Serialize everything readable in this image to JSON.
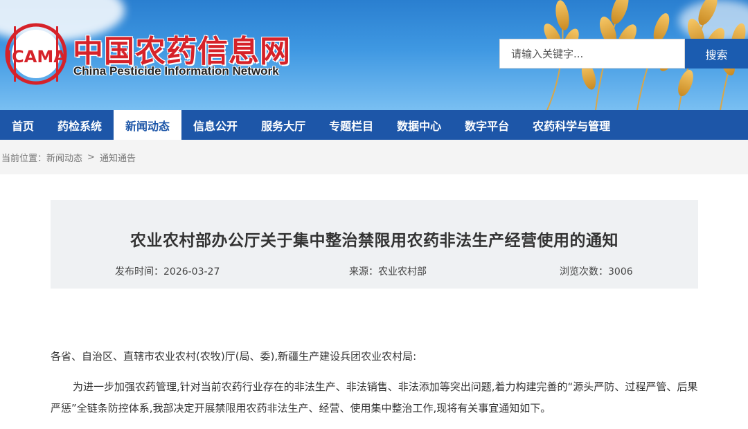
{
  "header": {
    "logo_text": "ICAMA",
    "site_title": "中国农药信息网",
    "site_subtitle": "China Pesticide Information Network",
    "search_placeholder": "请输入关键字...",
    "search_button": "搜索"
  },
  "nav": {
    "items": [
      {
        "label": "首页",
        "active": false
      },
      {
        "label": "药检系统",
        "active": false
      },
      {
        "label": "新闻动态",
        "active": true
      },
      {
        "label": "信息公开",
        "active": false
      },
      {
        "label": "服务大厅",
        "active": false
      },
      {
        "label": "专题栏目",
        "active": false
      },
      {
        "label": "数据中心",
        "active": false
      },
      {
        "label": "数字平台",
        "active": false
      },
      {
        "label": "农药科学与管理",
        "active": false
      }
    ]
  },
  "breadcrumb": {
    "prefix": "当前位置：",
    "items": [
      "新闻动态",
      "通知通告"
    ],
    "separator": ">"
  },
  "article": {
    "title": "农业农村部办公厅关于集中整治禁限用农药非法生产经营使用的通知",
    "date": "发布时间：2026-03-27",
    "source": "来源：农业农村部",
    "views": "浏览次数：3006",
    "salutation": "各省、自治区、直辖市农业农村(农牧)厅(局、委),新疆生产建设兵团农业农村局:",
    "paragraph1": "为进一步加强农药管理,针对当前农药行业存在的非法生产、非法销售、非法添加等突出问题,着力构建完善的“源头严防、过程严管、后果严惩”全链条防控体系,我部决定开展禁限用农药非法生产、经营、使用集中整治工作,现将有关事宜通知如下。"
  },
  "colors": {
    "nav_bg": "#1d56a8",
    "search_btn": "#1b5cb0",
    "logo_red": "#d62229",
    "article_box_bg": "#eff1f3"
  }
}
